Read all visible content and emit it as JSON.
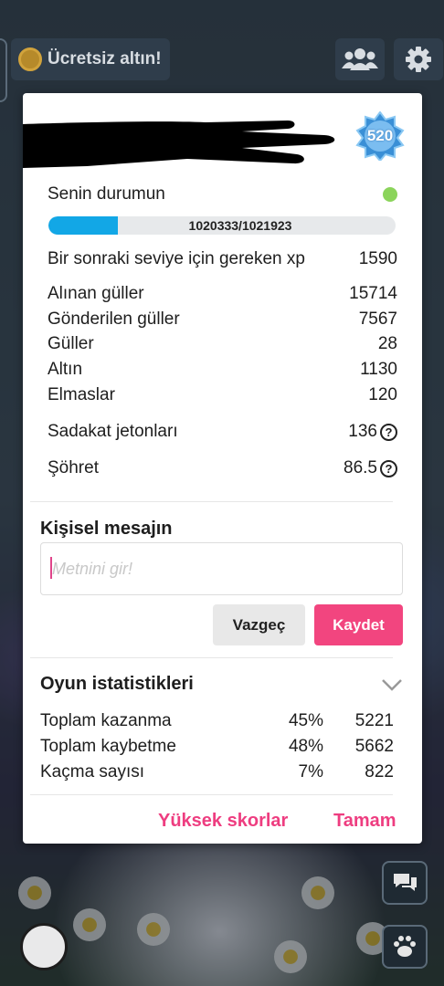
{
  "topbar": {
    "free_gold_label": "Ücretsiz altın!"
  },
  "profile": {
    "level": "520",
    "status_label": "Senin durumun",
    "xp_text": "1020333/1021923",
    "xp_progress": 0.2,
    "status_color": "#8bd45b",
    "accent_color": "#f2457f",
    "xp_bar_color": "#12a7e6"
  },
  "stats": {
    "next_level_label": "Bir sonraki seviye için gereken xp",
    "next_level_value": "1590",
    "roses_received_label": "Alınan güller",
    "roses_received_value": "15714",
    "roses_sent_label": "Gönderilen güller",
    "roses_sent_value": "7567",
    "roses_label": "Güller",
    "roses_value": "28",
    "gold_label": "Altın",
    "gold_value": "1130",
    "diamonds_label": "Elmaslar",
    "diamonds_value": "120",
    "loyalty_label": "Sadakat jetonları",
    "loyalty_value": "136",
    "fame_label": "Şöhret",
    "fame_value": "86.5",
    "help_glyph": "?"
  },
  "message": {
    "title": "Kişisel mesajın",
    "placeholder": "Metnini gir!",
    "cancel_label": "Vazgeç",
    "save_label": "Kaydet"
  },
  "game_stats": {
    "title": "Oyun istatistikleri",
    "rows": [
      {
        "label": "Toplam kazanma",
        "percent": "45%",
        "count": "5221"
      },
      {
        "label": "Toplam kaybetme",
        "percent": "48%",
        "count": "5662"
      },
      {
        "label": "Kaçma sayısı",
        "percent": "7%",
        "count": "822"
      }
    ]
  },
  "footer": {
    "high_scores_label": "Yüksek skorlar",
    "ok_label": "Tamam"
  }
}
